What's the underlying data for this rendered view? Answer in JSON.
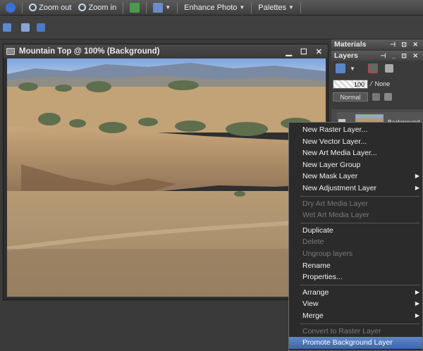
{
  "toolbar": {
    "zoom_out": "Zoom out",
    "zoom_in": "Zoom in",
    "enhance_photo": "Enhance Photo",
    "palettes": "Palettes"
  },
  "document": {
    "title": "Mountain Top @ 100% (Background)"
  },
  "materials_panel": {
    "title": "Materials"
  },
  "layers_panel": {
    "title": "Layers",
    "opacity": "100",
    "none_label": "None",
    "blend_mode": "Normal",
    "layer_name": "Background"
  },
  "context_menu": {
    "items": [
      {
        "label": "New Raster Layer...",
        "enabled": true
      },
      {
        "label": "New Vector Layer...",
        "enabled": true
      },
      {
        "label": "New Art Media Layer...",
        "enabled": true
      },
      {
        "label": "New Layer Group",
        "enabled": true
      },
      {
        "label": "New Mask Layer",
        "enabled": true,
        "submenu": true
      },
      {
        "label": "New Adjustment Layer",
        "enabled": true,
        "submenu": true
      },
      {
        "label": "Dry Art Media Layer",
        "enabled": false
      },
      {
        "label": "Wet Art Media Layer",
        "enabled": false
      },
      {
        "label": "Duplicate",
        "enabled": true
      },
      {
        "label": "Delete",
        "enabled": false
      },
      {
        "label": "Ungroup layers",
        "enabled": false
      },
      {
        "label": "Rename",
        "enabled": true
      },
      {
        "label": "Properties...",
        "enabled": true
      },
      {
        "label": "Arrange",
        "enabled": true,
        "submenu": true
      },
      {
        "label": "View",
        "enabled": true,
        "submenu": true
      },
      {
        "label": "Merge",
        "enabled": true,
        "submenu": true
      },
      {
        "label": "Convert to Raster Layer",
        "enabled": false
      },
      {
        "label": "Promote Background Layer",
        "enabled": true,
        "selected": true
      }
    ]
  }
}
